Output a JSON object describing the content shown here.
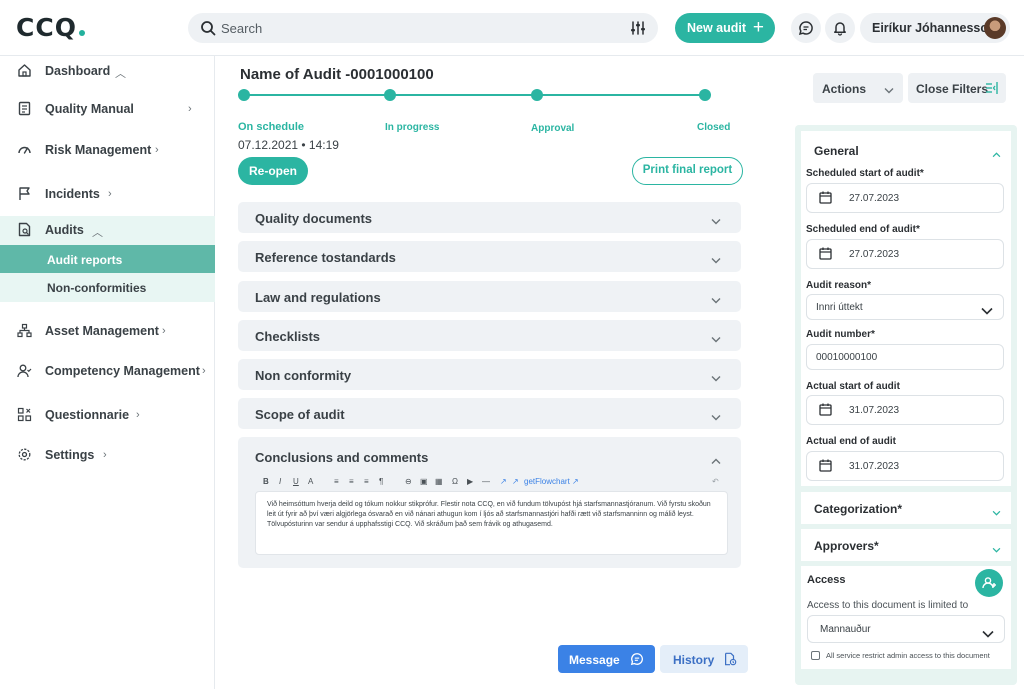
{
  "app": {
    "logo_text": "CCQ",
    "accent": "#2bb5a2"
  },
  "topbar": {
    "search_placeholder": "Search",
    "new_audit_label": "New audit",
    "user_name": "Eiríkur Jóhannesson"
  },
  "sidebar": {
    "items": [
      {
        "label": "Dashboard",
        "icon": "home-icon",
        "chevron": "^"
      },
      {
        "label": "Quality Manual",
        "icon": "book-icon",
        "chevron": "›"
      },
      {
        "label": "Risk Management",
        "icon": "gauge-icon",
        "chevron": "›"
      },
      {
        "label": "Incidents",
        "icon": "flag-icon",
        "chevron": "›"
      },
      {
        "label": "Audits",
        "icon": "audit-document-icon",
        "chevron": "^"
      },
      {
        "label": "Asset Management",
        "icon": "hierarchy-icon",
        "chevron": "›"
      },
      {
        "label": "Competency Management",
        "icon": "user-skill-icon",
        "chevron": "›"
      },
      {
        "label": "Questionnarie",
        "icon": "grid-icon",
        "chevron": "›"
      },
      {
        "label": "Settings",
        "icon": "gear-icon",
        "chevron": "›"
      }
    ],
    "audit_subitems": [
      {
        "label": "Audit reports",
        "active": true
      },
      {
        "label": "Non-conformities",
        "active": false
      }
    ]
  },
  "main": {
    "title": "Name of Audit -0001000100",
    "progress_steps": [
      "On schedule",
      "In progress",
      "Approval",
      "Closed"
    ],
    "date": "07.12.2021 • 14:19",
    "reopen_label": "Re-open",
    "print_label": "Print final report",
    "sections": [
      "Quality documents",
      "Reference tostandards",
      "Law and regulations",
      "Checklists",
      "Non conformity",
      "Scope of audit"
    ],
    "open_section": {
      "title": "Conclusions and comments",
      "toolbar": [
        "B",
        "I",
        "U",
        "A",
        "≡",
        "≡",
        "≡",
        "¶",
        "⊖",
        "▣",
        "▦",
        "Ω",
        "▶",
        "—",
        "↗",
        "↗",
        "getFlowchart ↗",
        "↶"
      ],
      "text": "Við heimsóttum hverja deild og tókum nokkur stikprófur. Flestir nota CCQ, en við fundum tölvupóst hjá starfsmannastjóranum. Við fyrstu skoðun leit út fyrir að því væri algjörlega ósvarað en við nánari athugun kom í ljós að starfsmannastjóri hafði rætt við starfsmanninn og málið leyst. Tölvupósturinn var sendur á upphafsstigi CCQ. Við skráðum það sem frávik og athugasemd."
    },
    "message_label": "Message",
    "history_label": "History"
  },
  "rpanel": {
    "actions_label": "Actions",
    "close_filters_label": "Close Filters",
    "general": {
      "title": "General",
      "fields": [
        {
          "label": "Scheduled start of audit*",
          "value": "27.07.2023",
          "type": "date"
        },
        {
          "label": "Scheduled end of audit*",
          "value": "27.07.2023",
          "type": "date"
        },
        {
          "label": "Audit reason*",
          "value": "Innri úttekt",
          "type": "select"
        },
        {
          "label": "Audit number*",
          "value": "00010000100",
          "type": "text"
        },
        {
          "label": "Actual start of audit",
          "value": "31.07.2023",
          "type": "date"
        },
        {
          "label": "Actual end of audit",
          "value": "31.07.2023",
          "type": "date"
        }
      ]
    },
    "categorization_title": "Categorization*",
    "approvers_title": "Approvers*",
    "access": {
      "title": "Access",
      "note": "Access to this document is limited to",
      "select_value": "Mannauður",
      "checkbox_label": "All service restrict admin access to this document"
    }
  }
}
